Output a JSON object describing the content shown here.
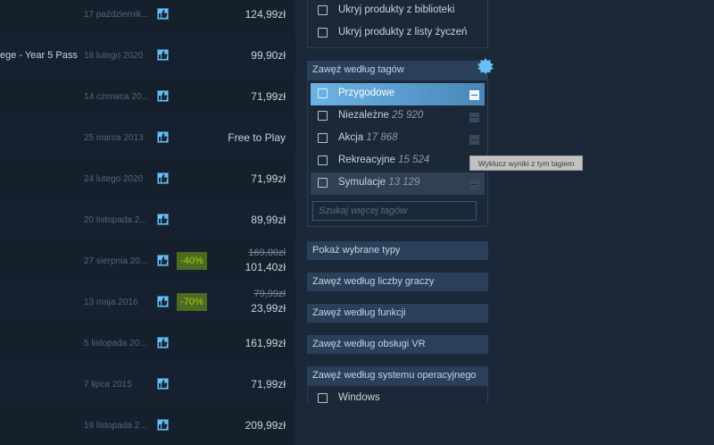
{
  "results": [
    {
      "title": "",
      "date": "17 październik...",
      "price": "124,99zł"
    },
    {
      "title": "ege - Year 5 Pass",
      "date": "18 lutego 2020",
      "price": "99,90zł"
    },
    {
      "title": "",
      "date": "14 czerwca 20...",
      "price": "71,99zł"
    },
    {
      "title": "",
      "date": "25 marca 2013",
      "price": "Free to Play"
    },
    {
      "title": "",
      "date": "24 lutego 2020",
      "price": "71,99zł"
    },
    {
      "title": "",
      "date": "20 listopada 2...",
      "price": "89,99zł"
    },
    {
      "title": "",
      "date": "27 sierpnia 20...",
      "discount": "-40%",
      "original_price": "169,00zł",
      "price": "101,40zł"
    },
    {
      "title": "",
      "date": "13 maja 2016",
      "discount": "-70%",
      "original_price": "79,99zł",
      "price": "23,99zł"
    },
    {
      "title": "",
      "date": "5 listopada 20...",
      "price": "161,99zł"
    },
    {
      "title": "",
      "date": "7 lipca 2015",
      "price": "71,99zł"
    },
    {
      "title": "",
      "date": "19 listopada 2...",
      "price": "209,99zł"
    }
  ],
  "sidebar": {
    "hide_options": [
      "Ukryj produkty z biblioteki",
      "Ukryj produkty z listy życzeń"
    ],
    "tags_header": "Zawęź według tagów",
    "tags": [
      {
        "label": "Przygodowe",
        "count": "",
        "selected": true
      },
      {
        "label": "Niezależne",
        "count": "25 920"
      },
      {
        "label": "Akcja",
        "count": "17 868"
      },
      {
        "label": "Rekreacyjne",
        "count": "15 524"
      },
      {
        "label": "Symulacje",
        "count": "13 129",
        "hover": true
      }
    ],
    "tag_search_placeholder": "Szukaj więcej tagów",
    "tooltip": "Wyklucz wyniki z tym tagiem",
    "sections": [
      "Pokaż wybrane typy",
      "Zawęź według liczby graczy",
      "Zawęź według funkcji",
      "Zawęź według obsługi VR",
      "Zawęź według systemu operacyjnego"
    ],
    "os_options": [
      "Windows"
    ]
  },
  "colors": {
    "background": "#1b2838",
    "header": "#2a3f5a",
    "accent": "#66c0f4",
    "discount_bg": "#4c6b22",
    "discount_text": "#a4d007"
  }
}
